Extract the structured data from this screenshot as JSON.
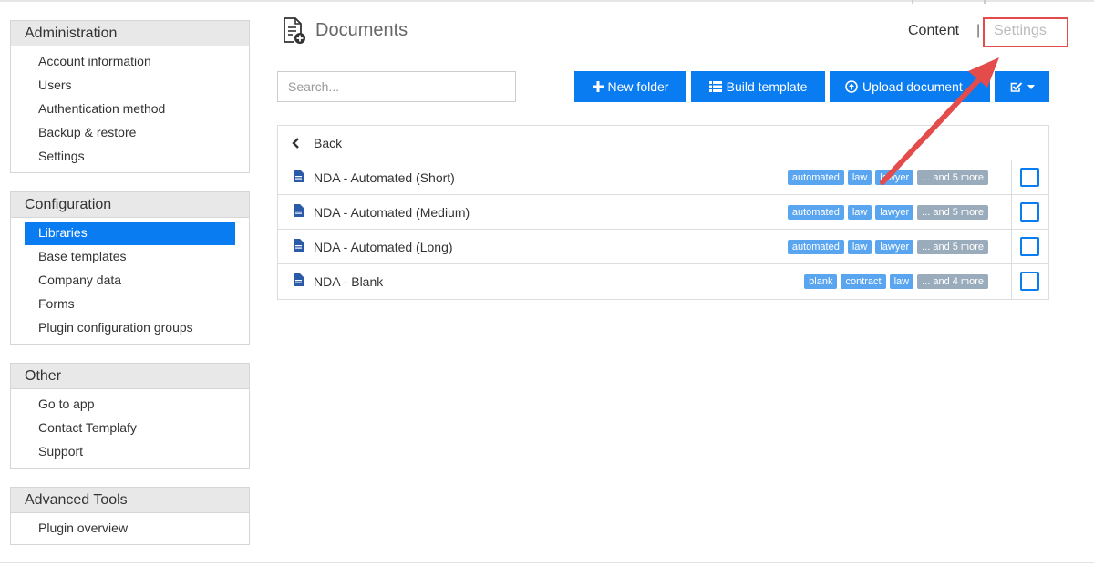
{
  "sidebar": {
    "sections": [
      {
        "title": "Administration",
        "items": [
          "Account information",
          "Users",
          "Authentication method",
          "Backup & restore",
          "Settings"
        ]
      },
      {
        "title": "Configuration",
        "items": [
          "Libraries",
          "Base templates",
          "Company data",
          "Forms",
          "Plugin configuration groups"
        ],
        "active": "Libraries"
      },
      {
        "title": "Other",
        "items": [
          "Go to app",
          "Contact Templafy",
          "Support"
        ]
      },
      {
        "title": "Advanced Tools",
        "items": [
          "Plugin overview"
        ]
      }
    ]
  },
  "header": {
    "title": "Documents",
    "icon": "document-add-icon",
    "nav": {
      "content": "Content",
      "separator": "|",
      "settings": "Settings"
    }
  },
  "toolbar": {
    "search_placeholder": "Search...",
    "new_folder": "New folder",
    "build_template": "Build template",
    "upload_document": "Upload document"
  },
  "list": {
    "back_label": "Back",
    "rows": [
      {
        "name": "NDA - Automated (Short)",
        "tags": [
          "automated",
          "law",
          "lawyer"
        ],
        "more": "... and 5 more"
      },
      {
        "name": "NDA - Automated (Medium)",
        "tags": [
          "automated",
          "law",
          "lawyer"
        ],
        "more": "... and 5 more"
      },
      {
        "name": "NDA - Automated (Long)",
        "tags": [
          "automated",
          "law",
          "lawyer"
        ],
        "more": "... and 5 more"
      },
      {
        "name": "NDA - Blank",
        "tags": [
          "blank",
          "contract",
          "law"
        ],
        "more": "... and 4 more"
      }
    ]
  },
  "colors": {
    "accent": "#0a7cf2",
    "tag": "#5aa5ef",
    "tag_more": "#9aacbb",
    "annotation": "#e44b4b"
  }
}
